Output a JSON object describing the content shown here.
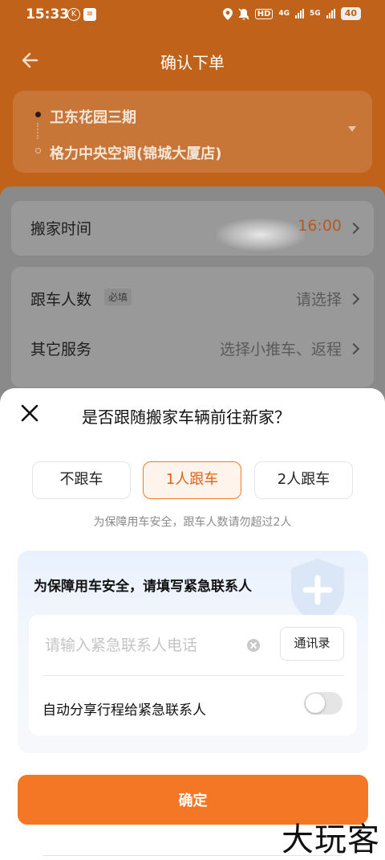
{
  "status_bar": {
    "time": "15:33",
    "app_icon_1": "K",
    "app_icon_2": "≡",
    "hd_label": "HD",
    "net_4g": "4G",
    "net_5g": "5G",
    "battery": "40",
    "icons": [
      "location-icon",
      "mute-icon",
      "hd-icon",
      "signal-icon",
      "battery-icon"
    ]
  },
  "header": {
    "title": "确认下单",
    "back_icon": "back-arrow-icon"
  },
  "route": {
    "from": "卫东花园三期",
    "to": "格力中央空调(锦城大厦店)",
    "expand_icon": "caret-down-icon"
  },
  "order": {
    "moving_time_label": "搬家时间",
    "moving_time_value": "16:00",
    "companions_label": "跟车人数",
    "companions_required": "必填",
    "companions_value": "请选择",
    "other_services_label": "其它服务",
    "other_services_value": "选择小推车、返程"
  },
  "sheet": {
    "title": "是否跟随搬家车辆前往新家？",
    "options": [
      {
        "label": "不跟车",
        "selected": false
      },
      {
        "label": "1人跟车",
        "selected": true
      },
      {
        "label": "2人跟车",
        "selected": false
      }
    ],
    "hint": "为保障用车安全，跟车人数请勿超过2人",
    "contact": {
      "heading": "为保障用车安全，请填写紧急联系人",
      "phone_placeholder": "请输入紧急联系人电话",
      "phone_value": "",
      "contacts_button": "通讯录",
      "share_label": "自动分享行程给紧急联系人",
      "share_enabled": false
    },
    "confirm_button": "确定"
  },
  "watermark": "大玩客",
  "colors": {
    "brand_orange": "#f47725",
    "selected_text": "#e0621a",
    "header_bg": "#c0621a"
  }
}
